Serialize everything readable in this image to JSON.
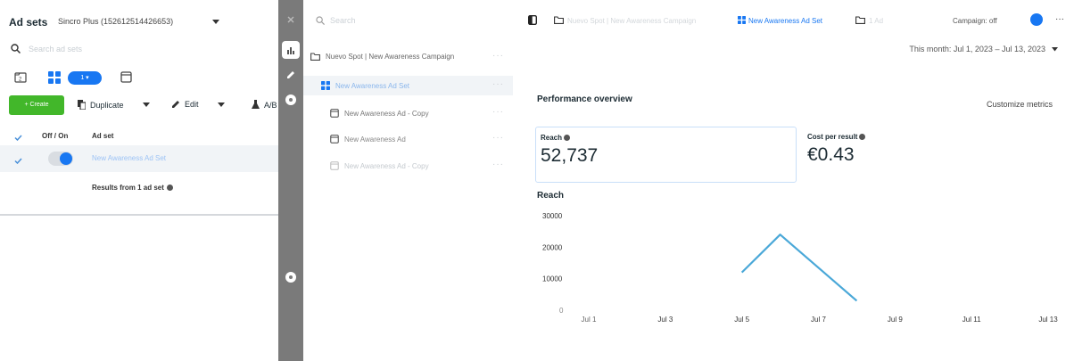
{
  "left_panel": {
    "title": "Ad sets",
    "account": "Sincro Plus (152612514426653)",
    "search_placeholder": "Search ad sets",
    "view_pill": "1 ▾",
    "toolbar": {
      "create": "+ Create",
      "duplicate": "Duplicate",
      "edit": "Edit",
      "ab_test": "A/B"
    },
    "columns": {
      "off_on": "Off / On",
      "ad_set": "Ad set"
    },
    "rows": [
      {
        "name": "New Awareness Ad Set",
        "on": true
      }
    ],
    "results_summary": "Results from 1 ad set"
  },
  "tree_panel": {
    "search_placeholder": "Search",
    "items": [
      {
        "label": "Nuevo Spot | New Awareness Campaign",
        "icon": "folder-icon"
      },
      {
        "label": "New Awareness Ad Set",
        "icon": "adset-grid-icon",
        "selected": true
      },
      {
        "label": "New Awareness Ad - Copy",
        "icon": "ad-icon"
      },
      {
        "label": "New Awareness Ad",
        "icon": "ad-icon"
      },
      {
        "label": "New Awareness Ad - Copy",
        "icon": "ad-icon"
      }
    ]
  },
  "perf_panel": {
    "breadcrumb": {
      "campaign": "Nuevo Spot | New Awareness Campaign",
      "adset": "New Awareness Ad Set",
      "ad": "1 Ad"
    },
    "campaign_toggle_label": "Campaign: off",
    "date_range": "This month: Jul 1, 2023 – Jul 13, 2023",
    "section_title": "Performance overview",
    "customize_label": "Customize metrics",
    "metrics": [
      {
        "label": "Reach",
        "value": "52,737"
      },
      {
        "label": "Cost per result",
        "value": "€0.43"
      }
    ],
    "chart_title": "Reach",
    "colors": {
      "accent": "#1877f2",
      "line": "#4aa8d8",
      "create": "#42b72a"
    }
  },
  "chart_data": {
    "type": "line",
    "title": "Reach",
    "xlabel": "",
    "ylabel": "",
    "ylim": [
      0,
      30000
    ],
    "y_ticks": [
      "30000",
      "20000",
      "10000",
      "0"
    ],
    "x_ticks": [
      "Jul 1",
      "Jul 3",
      "Jul 5",
      "Jul 7",
      "Jul 9",
      "Jul 11",
      "Jul 13"
    ],
    "series": [
      {
        "points": [
          [
            "Jul 5",
            12000
          ],
          [
            "Jul 6",
            24000
          ],
          [
            "Jul 8",
            3000
          ]
        ]
      }
    ]
  }
}
